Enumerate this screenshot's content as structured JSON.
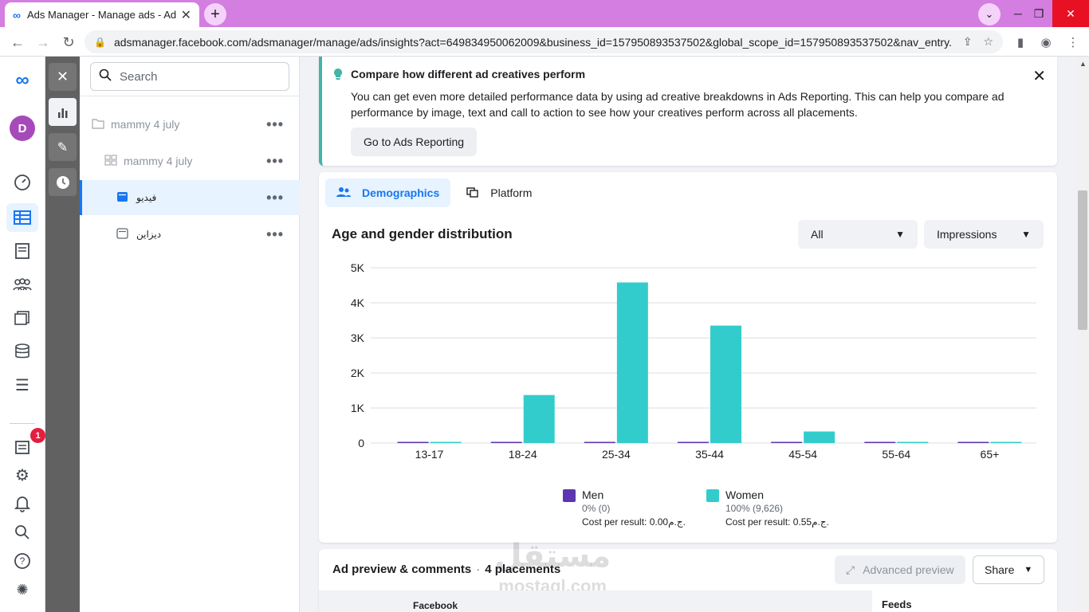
{
  "browser": {
    "tab_title": "Ads Manager - Manage ads - Ad",
    "url": "adsmanager.facebook.com/adsmanager/manage/ads/insights?act=649834950062009&business_id=157950893537502&global_scope_id=157950893537502&nav_entry..."
  },
  "global_nav": {
    "avatar_letter": "D",
    "notification_count": "1"
  },
  "tree": {
    "search_placeholder": "Search",
    "items": [
      {
        "label": "mammy 4 july"
      },
      {
        "label": "mammy 4 july"
      },
      {
        "label": "فيديو"
      },
      {
        "label": "ديزاين"
      }
    ]
  },
  "tip": {
    "title": "Compare how different ad creatives perform",
    "body": "You can get even more detailed performance data by using ad creative breakdowns in Ads Reporting. This can help you compare ad performance by image, text and call to action to see how your creatives perform across all placements.",
    "button": "Go to Ads Reporting"
  },
  "tabs": {
    "demographics": "Demographics",
    "platform": "Platform"
  },
  "chart_section": {
    "title": "Age and gender distribution",
    "filter_value": "All",
    "metric_value": "Impressions"
  },
  "chart_data": {
    "type": "bar",
    "title": "Age and gender distribution",
    "categories": [
      "13-17",
      "18-24",
      "25-34",
      "35-44",
      "45-54",
      "55-64",
      "65+"
    ],
    "series": [
      {
        "name": "Men",
        "values": [
          0,
          0,
          0,
          0,
          0,
          0,
          0
        ],
        "color": "#5e35b1"
      },
      {
        "name": "Women",
        "values": [
          0,
          1370,
          4580,
          3350,
          330,
          0,
          0
        ],
        "color": "#33cccc"
      }
    ],
    "yticks": [
      "0",
      "1K",
      "2K",
      "3K",
      "4K",
      "5K"
    ],
    "ylim": [
      0,
      5000
    ],
    "grid": true,
    "legend_position": "bottom"
  },
  "legend": {
    "men": {
      "label": "Men",
      "stats": "0% (0)",
      "cost": "Cost per result: 0.00ج.م."
    },
    "women": {
      "label": "Women",
      "stats": "100% (9,626)",
      "cost": "Cost per result: 0.55ج.م."
    }
  },
  "preview": {
    "title": "Ad preview & comments",
    "placements": "4 placements",
    "advanced_btn": "Advanced preview",
    "share_btn": "Share",
    "facebook_label": "Facebook",
    "feeds_label": "Feeds"
  },
  "watermark": {
    "text": "مستقل",
    "sub": "mostaql.com"
  }
}
